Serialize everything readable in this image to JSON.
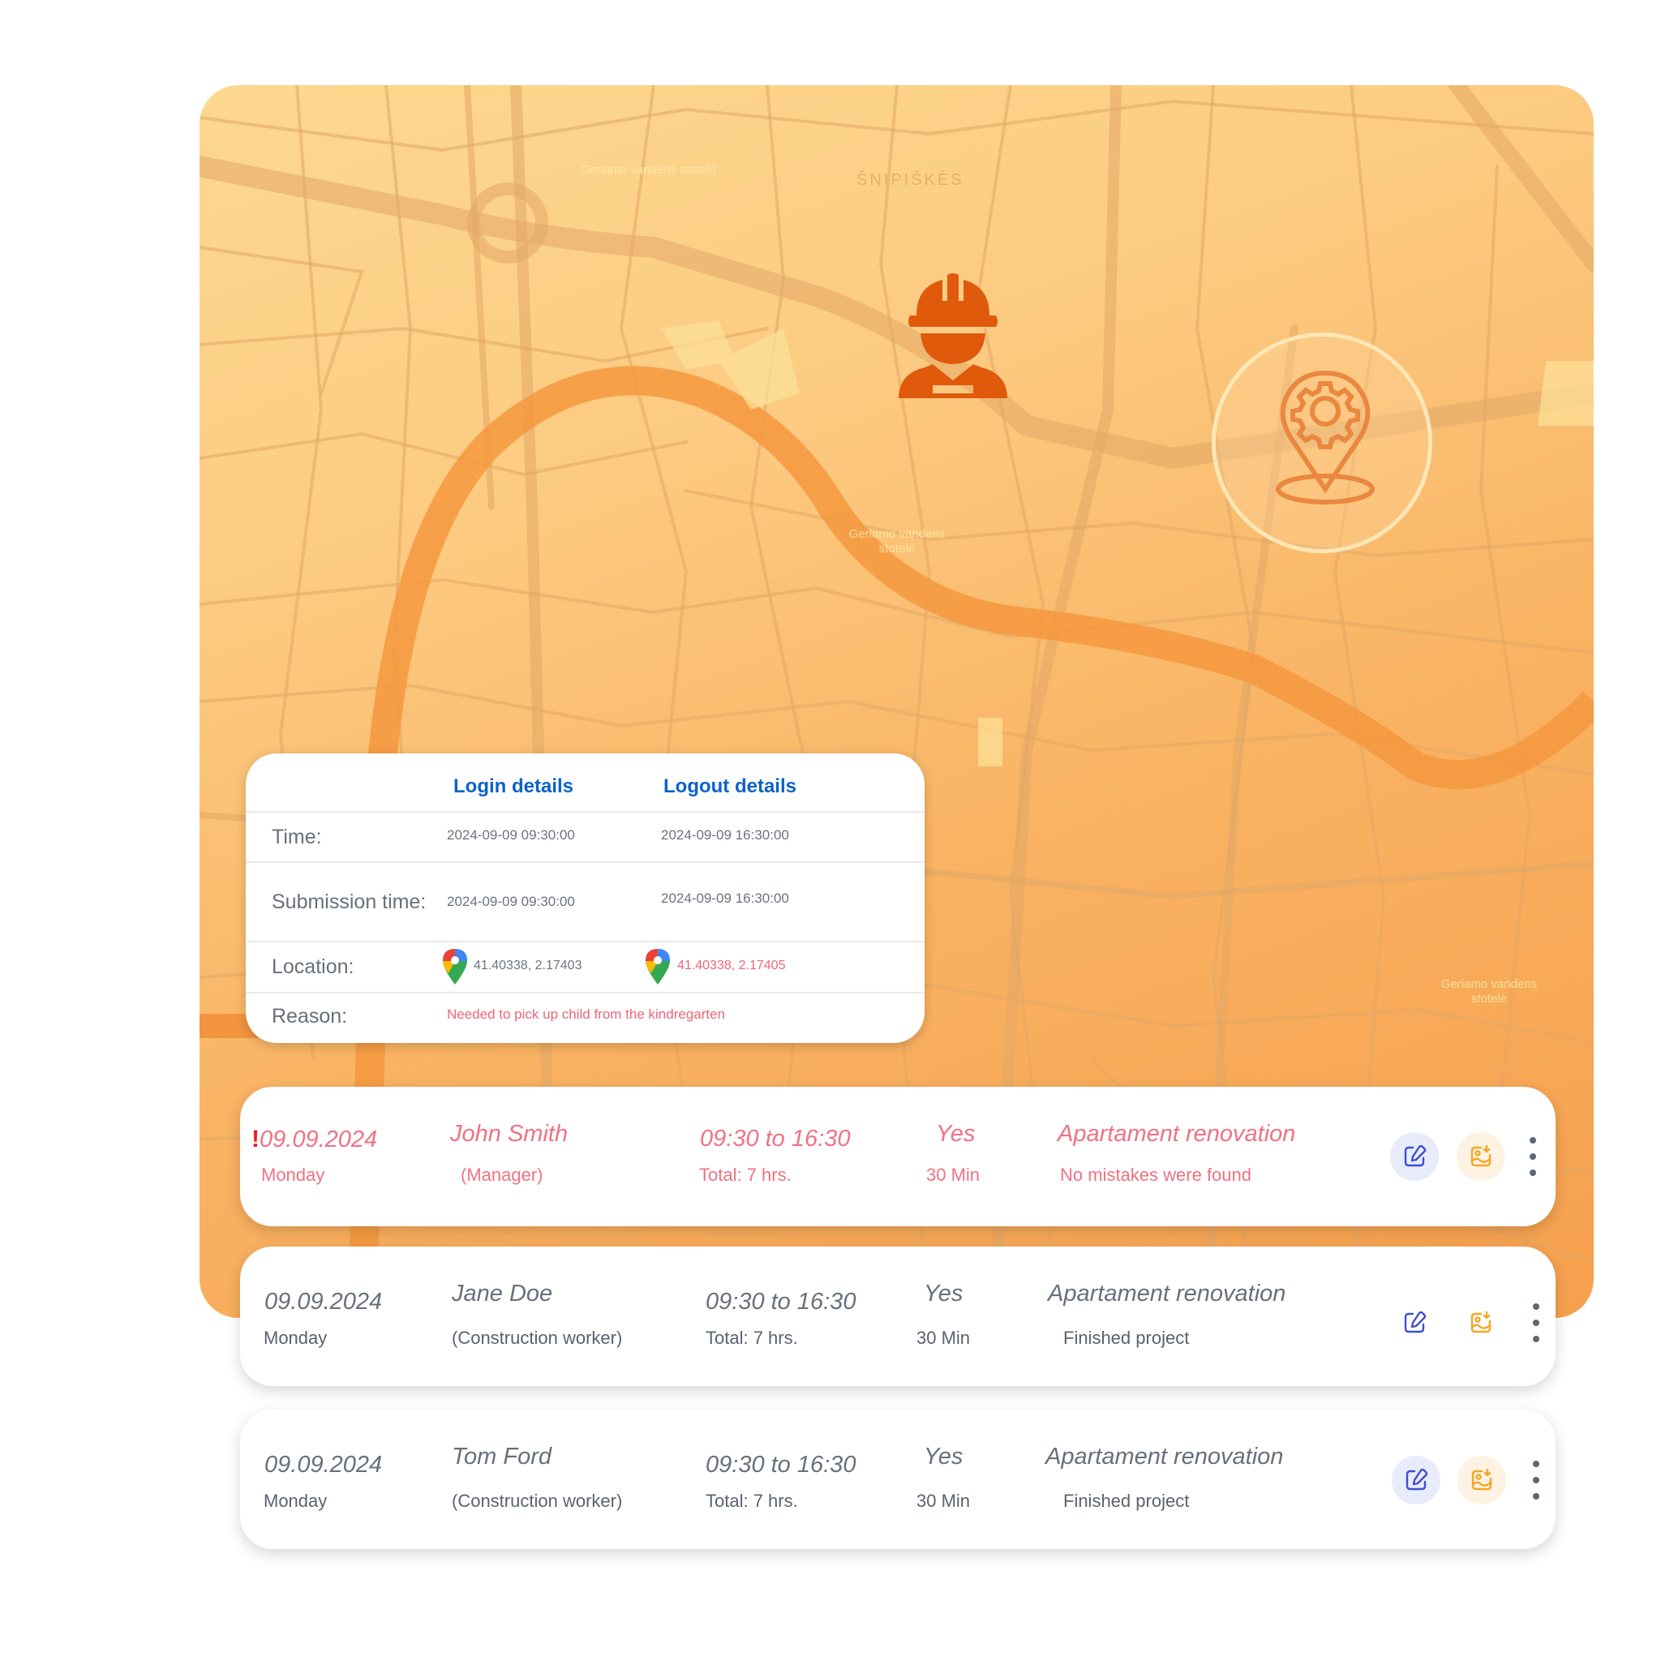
{
  "map": {
    "labels": {
      "poi_1": "Geriamo vandens stotelė",
      "district": "ŠNIPIŠKĖS",
      "poi_2": "Geriamo vandens stotelė",
      "poi_3": "Geriamo vandens stotelė"
    },
    "colors": {
      "worker_icon": "#e05a0c",
      "pin_icon": "#ea8840"
    },
    "icons": [
      "construction-worker-icon",
      "location-gear-pin-icon"
    ]
  },
  "login_card": {
    "headers": {
      "login": "Login details",
      "logout": "Logout details"
    },
    "rows": {
      "time": {
        "label": "Time:",
        "login": "2024-09-09 09:30:00",
        "logout": "2024-09-09 16:30:00"
      },
      "submission": {
        "label": "Submission time:",
        "login": "2024-09-09 09:30:00",
        "logout": "2024-09-09 16:30:00"
      },
      "location": {
        "label": "Location:",
        "login": "41.40338, 2.17403",
        "logout": "41.40338, 2.17405"
      },
      "reason": {
        "label": "Reason:",
        "value": "Needed to pick up child from the kindregarten"
      }
    },
    "colors": {
      "header": "#0d62c9",
      "warning": "#ef6478"
    }
  },
  "entries": [
    {
      "flag": "!",
      "date": "09.09.2024",
      "weekday": "Monday",
      "name": "John Smith",
      "role": "(Manager)",
      "time_range": "09:30 to 16:30",
      "total": "Total: 7 hrs.",
      "break": "Yes",
      "break_duration": "30 Min",
      "project": "Apartament renovation",
      "note": "No mistakes were found",
      "alert": true
    },
    {
      "flag": "",
      "date": "09.09.2024",
      "weekday": "Monday",
      "name": "Jane Doe",
      "role": "(Construction worker)",
      "time_range": "09:30 to 16:30",
      "total": "Total: 7 hrs.",
      "break": "Yes",
      "break_duration": "30 Min",
      "project": "Apartament renovation",
      "note": "Finished project",
      "alert": false
    },
    {
      "flag": "",
      "date": "09.09.2024",
      "weekday": "Monday",
      "name": "Tom Ford",
      "role": "(Construction worker)",
      "time_range": "09:30 to 16:30",
      "total": "Total: 7 hrs.",
      "break": "Yes",
      "break_duration": "30 Min",
      "project": "Apartament renovation",
      "note": "Finished project",
      "alert": false
    }
  ],
  "actions": {
    "edit_icon": "edit-icon",
    "image_icon": "image-download-icon",
    "more_icon": "more-vertical-icon"
  }
}
